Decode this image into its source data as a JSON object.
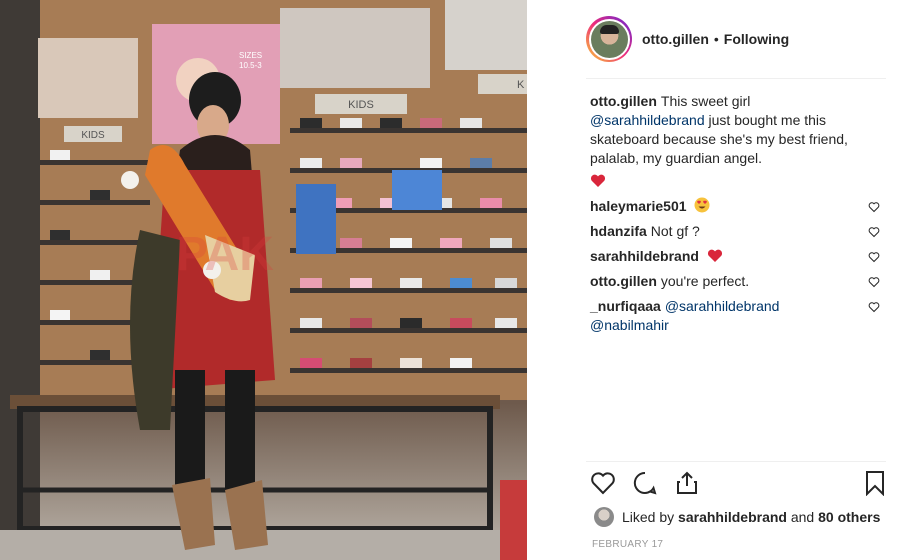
{
  "photo": {
    "alt_icon": "photo-carousel",
    "next_icon": "chevron-right-icon",
    "signs": {
      "sizes_title": "SIZES",
      "sizes_range": "10.5-3",
      "kids_left": "KIDS",
      "kids_center": "KIDS",
      "kids_right": "K"
    }
  },
  "header": {
    "username": "otto.gillen",
    "separator": "•",
    "follow_status": "Following"
  },
  "caption": {
    "username": "otto.gillen",
    "text_before": "This sweet girl ",
    "mention": "@sarahhildebrand",
    "text_after": " just bought me this skateboard because she's my best friend, palalab, my guardian angel."
  },
  "comments": [
    {
      "username": "haleymarie501",
      "text": "",
      "emoji": "heart-eyes-emoji"
    },
    {
      "username": "hdanzifa",
      "text": "Not gf ?",
      "emoji": ""
    },
    {
      "username": "sarahhildebrand",
      "text": "",
      "emoji": "heart-emoji"
    },
    {
      "username": "otto.gillen",
      "text": "you're perfect.",
      "emoji": ""
    },
    {
      "username": "_nurfiqaaa",
      "mention1": "@sarahhildebrand",
      "mention2": "@nabilmahir"
    }
  ],
  "actions": {
    "like_icon": "heart-outline-icon",
    "comment_icon": "comment-icon",
    "share_icon": "share-icon",
    "save_icon": "bookmark-icon"
  },
  "likes": {
    "prefix": "Liked by ",
    "user": "sarahhildebrand",
    "middle": " and ",
    "others": "80 others"
  },
  "date": "FEBRUARY 17",
  "colors": {
    "mention": "#003569",
    "text": "#262626",
    "muted": "#999999",
    "heart_red": "#ed4956"
  }
}
